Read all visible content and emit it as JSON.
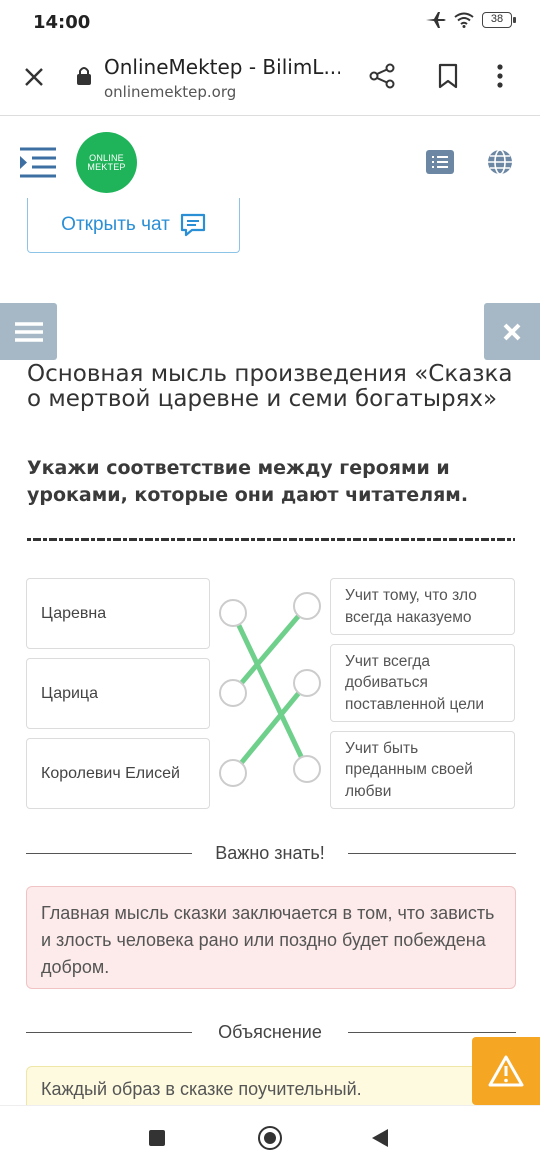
{
  "status": {
    "time": "14:00",
    "battery": "38"
  },
  "browser": {
    "title": "OnlineMektep - BilimL...",
    "url": "onlinemektep.org"
  },
  "header": {
    "logo_line1": "ONLINE",
    "logo_line2": "MEKTEP"
  },
  "chat": {
    "label": "Открыть чат"
  },
  "page": {
    "title": "Основная мысль произведения «Сказка о мертвой царевне и семи богатырях»",
    "question": "Укажи соответствие между героями и уроками, которые они дают читателям."
  },
  "matching": {
    "left": [
      "Царевна",
      "Царица",
      "Королевич Елисей"
    ],
    "right": [
      "Учит тому, что зло всегда наказуемо",
      "Учит всегда добиваться поставленной цели",
      "Учит быть преданным своей любви"
    ],
    "pairs": [
      [
        0,
        2
      ],
      [
        1,
        0
      ],
      [
        2,
        1
      ]
    ],
    "line_color": "#6fd08c"
  },
  "important": {
    "heading": "Важно знать!",
    "text": "Главная мысль сказки заключается в том, что зависть и злость человека рано или поздно будет побеждена добром."
  },
  "explanation": {
    "heading": "Объяснение",
    "text": "Каждый образ в сказке поучительный."
  },
  "colors": {
    "brand_green": "#1fb45a",
    "link_blue": "#2b8fd6",
    "side_button": "#a6b8c6",
    "warning": "#f5a623",
    "important_bg": "#fcebea",
    "explain_bg": "#fdfae0"
  }
}
